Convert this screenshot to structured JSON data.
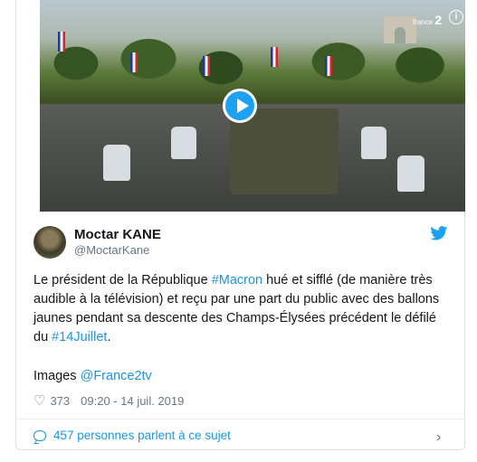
{
  "media": {
    "play_label": "Play video",
    "channel_logo": "france2-logo",
    "channel_text": "2",
    "channel_prefix": "france",
    "info_icon": "info-icon",
    "info_text": "i"
  },
  "author": {
    "name": "Moctar KANE",
    "handle": "@MoctarKane"
  },
  "tweet": {
    "part1": "Le président de la République ",
    "hashtag1": "#Macron",
    "part2": " hué et sifflé (de manière très audible à la télévision) et reçu par une part du public avec des ballons jaunes pendant sa descente des Champs-Élysées précédent le défilé du ",
    "hashtag2": "#14Juillet",
    "part3": ".",
    "images_label": "Images ",
    "images_mention": "@France2tv"
  },
  "meta": {
    "likes": "373",
    "timestamp": "09:20 - 14 juil. 2019"
  },
  "footer": {
    "discussion": "457 personnes parlent à ce sujet"
  },
  "colors": {
    "accent": "#1b95e0",
    "twitter_blue": "#1da1f2",
    "text": "#14171a",
    "muted": "#657786"
  }
}
